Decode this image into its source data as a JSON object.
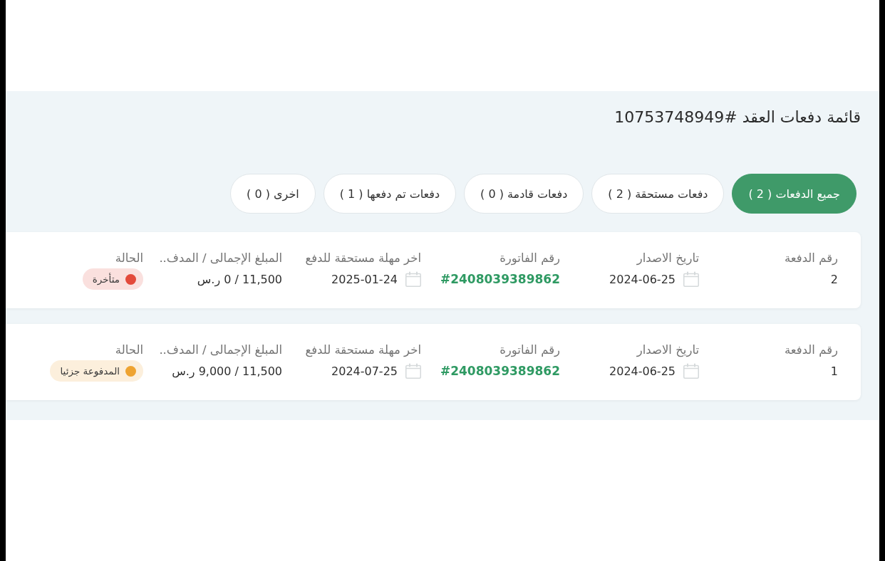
{
  "title": "قائمة دفعات العقد #10753748949",
  "tabs": [
    {
      "label": "جميع الدفعات ( 2 )",
      "selected": true
    },
    {
      "label": "دفعات مستحقة ( 2 )",
      "selected": false
    },
    {
      "label": "دفعات قادمة ( 0 )",
      "selected": false
    },
    {
      "label": "دفعات تم دفعها ( 1 )",
      "selected": false
    },
    {
      "label": "اخرى ( 0 )",
      "selected": false
    }
  ],
  "payments": [
    {
      "fields": [
        {
          "kind": "text",
          "label": "رقم الدفعة",
          "value": "2"
        },
        {
          "kind": "date",
          "label": "تاريخ الاصدار",
          "value": "2024-06-25"
        },
        {
          "kind": "invoice",
          "label": "رقم الفاتورة",
          "value": "#2408039389862"
        },
        {
          "kind": "date",
          "label": "اخر مهلة مستحقة للدفع",
          "value": "2025-01-24"
        },
        {
          "kind": "text",
          "label": "المبلغ الإجمالى / المدف..",
          "value": "11,500 / 0 ر.س"
        },
        {
          "kind": "status",
          "label": "الحالة",
          "value": "متأخرة",
          "color": "#e34a3b"
        }
      ]
    },
    {
      "fields": [
        {
          "kind": "text",
          "label": "رقم الدفعة",
          "value": "1"
        },
        {
          "kind": "date",
          "label": "تاريخ الاصدار",
          "value": "2024-06-25"
        },
        {
          "kind": "invoice",
          "label": "رقم الفاتورة",
          "value": "#2408039389862"
        },
        {
          "kind": "date",
          "label": "اخر مهلة مستحقة للدفع",
          "value": "2024-07-25"
        },
        {
          "kind": "text",
          "label": "المبلغ الإجمالى / المدف..",
          "value": "11,500 / 9,000 ر.س"
        },
        {
          "kind": "status",
          "label": "الحالة",
          "value": "المدفوعة جزئيا",
          "color": "#eea331"
        }
      ]
    }
  ]
}
